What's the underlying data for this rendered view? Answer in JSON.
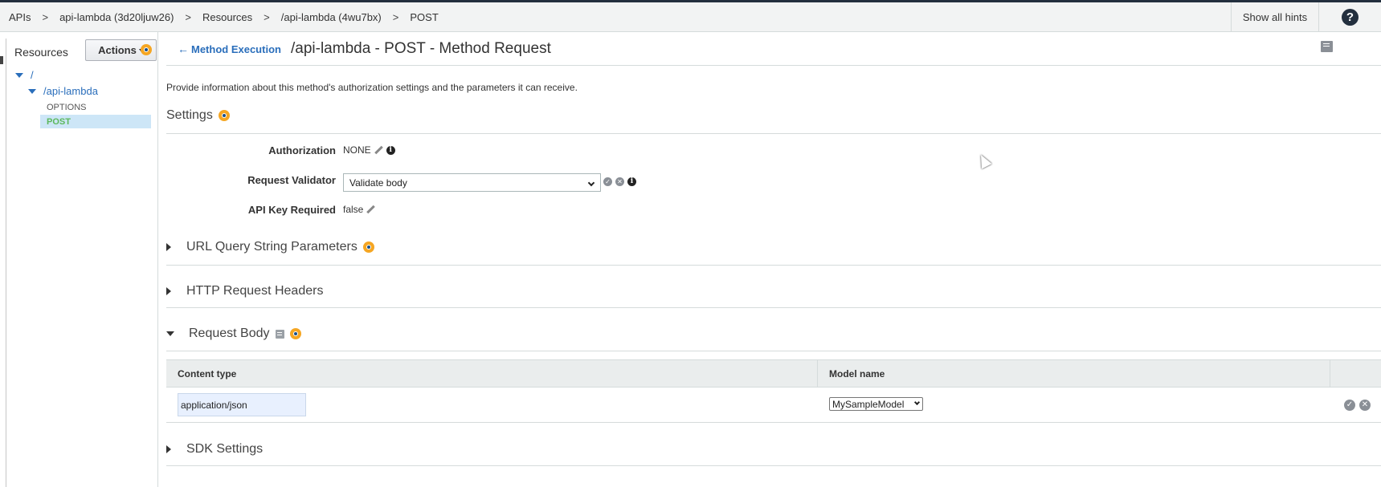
{
  "breadcrumb": [
    "APIs",
    "api-lambda (3d20ljuw26)",
    "Resources",
    "/api-lambda (4wu7bx)",
    "POST"
  ],
  "breadcrumb_separator": ">",
  "topbar": {
    "show_hints_label": "Show all hints",
    "help_glyph": "?"
  },
  "sidebar": {
    "title": "Resources",
    "actions_label": "Actions",
    "tree": {
      "root": "/",
      "child": "/api-lambda",
      "methods": [
        "OPTIONS",
        "POST"
      ],
      "selected_method": "POST"
    }
  },
  "header": {
    "back_label": "Method Execution",
    "title": "/api-lambda - POST - Method Request"
  },
  "description": "Provide information about this method's authorization settings and the parameters it can receive.",
  "settings": {
    "heading": "Settings",
    "authorization_label": "Authorization",
    "authorization_value": "NONE",
    "validator_label": "Request Validator",
    "validator_value": "Validate body",
    "api_key_label": "API Key Required",
    "api_key_value": "false"
  },
  "sections": {
    "query_params": "URL Query String Parameters",
    "headers": "HTTP Request Headers",
    "request_body": "Request Body",
    "sdk": "SDK Settings"
  },
  "request_body_table": {
    "columns": [
      "Content type",
      "Model name"
    ],
    "rows": [
      {
        "content_type": "application/json",
        "model_name": "MySampleModel"
      }
    ]
  },
  "colors": {
    "link": "#2a6ebb",
    "hint": "#f5a623",
    "selected_bg": "#cde6f7",
    "selected_text": "#5cb85c"
  }
}
